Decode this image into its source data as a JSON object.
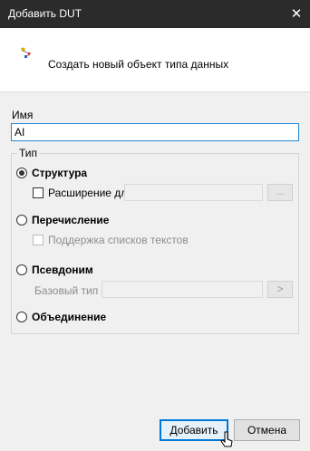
{
  "window": {
    "title": "Добавить DUT",
    "close_glyph": "✕"
  },
  "header": {
    "text": "Создать новый объект типа данных",
    "icon": "dut-type-icon"
  },
  "name": {
    "label": "Имя",
    "value": "AI"
  },
  "type_group": {
    "legend": "Тип",
    "structure": {
      "label": "Структура",
      "selected": true
    },
    "extension": {
      "label": "Расширение для",
      "checked": false,
      "browse_label": "..."
    },
    "enumeration": {
      "label": "Перечисление",
      "selected": false
    },
    "text_list_support": {
      "label": "Поддержка списков текстов",
      "checked": false
    },
    "alias": {
      "label": "Псевдоним",
      "selected": false
    },
    "base_type": {
      "label": "Базовый тип",
      "button_label": ">"
    },
    "union": {
      "label": "Объединение",
      "selected": false
    }
  },
  "buttons": {
    "add": "Добавить",
    "cancel": "Отмена"
  },
  "colors": {
    "titlebar": "#2b2b2b",
    "accent": "#0078d7",
    "input_border": "#1e88d3"
  }
}
